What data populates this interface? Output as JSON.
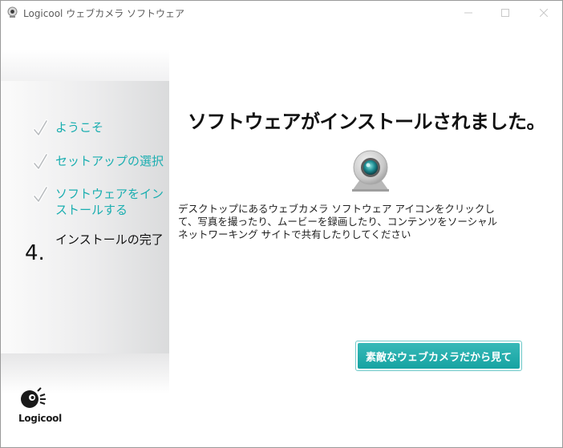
{
  "window": {
    "title": "Logicool ウェブカメラ ソフトウェア",
    "icon": "webcam-app-icon",
    "controls": {
      "minimize": "minimize-icon",
      "maximize": "maximize-icon",
      "close": "close-icon"
    }
  },
  "sidebar": {
    "steps": [
      {
        "label": "ようこそ",
        "state": "done",
        "icon": "check-icon"
      },
      {
        "label": "セットアップの選択",
        "state": "done",
        "icon": "check-icon"
      },
      {
        "label": "ソフトウェアをインストールする",
        "state": "done",
        "icon": "check-icon"
      },
      {
        "number": "4.",
        "label": "インストールの完了",
        "state": "current"
      }
    ]
  },
  "main": {
    "heading": "ソフトウェアがインストールされました。",
    "illustration": "webcam-icon",
    "description": "デスクトップにあるウェブカメラ ソフトウェア アイコンをクリックして、写真を撮ったり、ムービーを録画したり、コンテンツをソーシャル ネットワーキング サイトで共有したりしてください",
    "action_button": "素敵なウェブカメラだから見て"
  },
  "brand": {
    "name": "Logicool",
    "accent_color": "#1aaeb0"
  }
}
